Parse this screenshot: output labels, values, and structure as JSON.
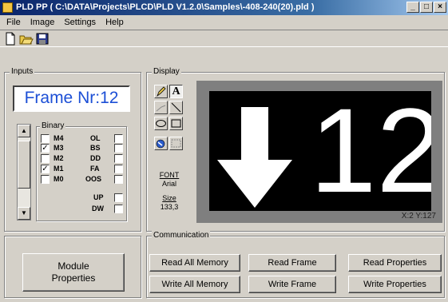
{
  "window": {
    "title": "PLD PP ( C:\\DATA\\Projects\\PLCD\\PLD V1.2.0\\Samples\\-408-240(20).pld )"
  },
  "menu": {
    "items": [
      "File",
      "Image",
      "Settings",
      "Help"
    ]
  },
  "inputs": {
    "group_label": "Inputs",
    "frame_display": "Frame Nr:12",
    "binary": {
      "group_label": "Binary",
      "left": [
        {
          "label": "M4",
          "checked": false,
          "mark": ""
        },
        {
          "label": "M3",
          "checked": true,
          "mark": "✓"
        },
        {
          "label": "M2",
          "checked": false,
          "mark": ""
        },
        {
          "label": "M1",
          "checked": true,
          "mark": "✓"
        },
        {
          "label": "M0",
          "checked": false,
          "mark": ""
        }
      ],
      "right": [
        {
          "label": "OL"
        },
        {
          "label": "BS"
        },
        {
          "label": "DD"
        },
        {
          "label": "FA"
        },
        {
          "label": "OOS"
        },
        {
          "label": "UP"
        },
        {
          "label": "DW"
        }
      ]
    }
  },
  "display": {
    "group_label": "Display",
    "font_label": "FONT",
    "font_name": "Arial",
    "size_label": "Size",
    "size_value": "133,3",
    "screen_text": "12",
    "coords": "X:2 Y:127"
  },
  "communication": {
    "group_label": "Communication",
    "buttons": {
      "read_all": "Read All Memory",
      "read_frame": "Read Frame",
      "read_props": "Read Properties",
      "write_all": "Write All Memory",
      "write_frame": "Write Frame",
      "write_props": "Write Properties"
    }
  },
  "module_button": {
    "line1": "Module",
    "line2": "Properties"
  }
}
